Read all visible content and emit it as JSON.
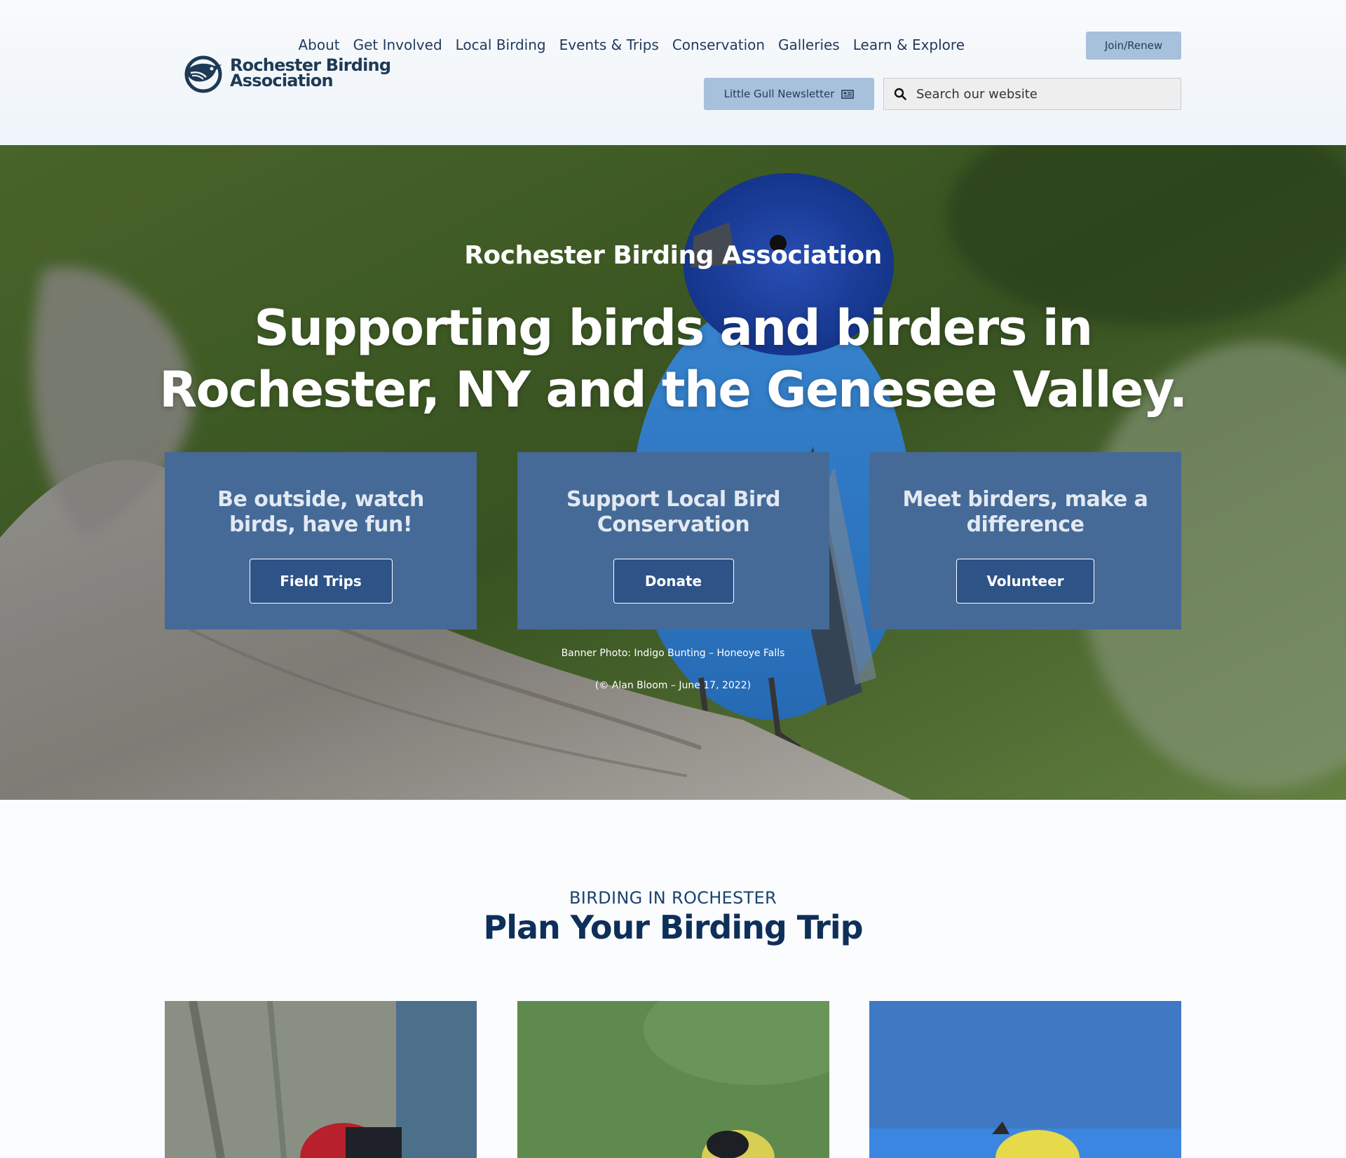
{
  "header": {
    "logo_line1": "Rochester Birding",
    "logo_line2": "Association",
    "nav": [
      "About",
      "Get Involved",
      "Local Birding",
      "Events & Trips",
      "Conservation",
      "Galleries",
      "Learn & Explore"
    ],
    "join_label": "Join/Renew",
    "newsletter_label": "Little Gull Newsletter",
    "search_placeholder": "Search our website"
  },
  "hero": {
    "eyebrow": "Rochester Birding Association",
    "title": "Supporting birds and birders in Rochester, NY and the Genesee Valley.",
    "cards": [
      {
        "heading": "Be outside, watch birds, have fun!",
        "button": "Field Trips"
      },
      {
        "heading": "Support Local Bird Conservation",
        "button": "Donate"
      },
      {
        "heading": "Meet birders, make a difference",
        "button": "Volunteer"
      }
    ],
    "credit_line1": "Banner Photo: Indigo Bunting – Honeoye Falls",
    "credit_line2": "(© Alan Bloom – June 17, 2022)"
  },
  "section": {
    "eyebrow": "BIRDING IN ROCHESTER",
    "title": "Plan Your Birding Trip"
  },
  "colors": {
    "card_bg": "#456a98",
    "button_bg": "#a7c0db",
    "heading": "#0e2f59",
    "bunting_blue": "#2f7fd0"
  }
}
